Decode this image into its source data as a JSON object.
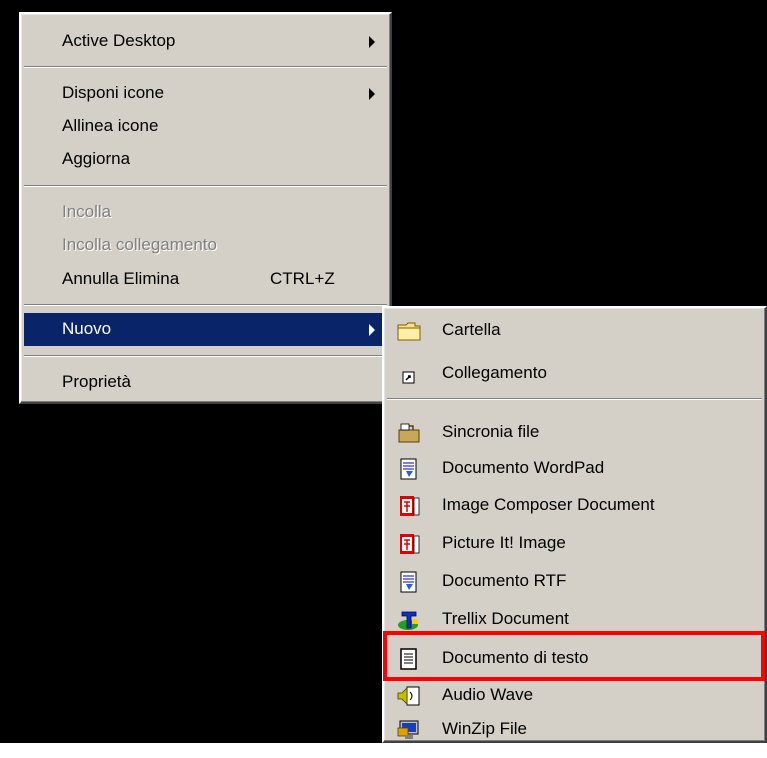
{
  "context_menu": {
    "items": [
      {
        "label": "Active Desktop",
        "has_submenu": true
      },
      {
        "label": "Disponi icone",
        "has_submenu": true
      },
      {
        "label": "Allinea icone"
      },
      {
        "label": "Aggiorna"
      },
      {
        "label": "Incolla",
        "disabled": true
      },
      {
        "label": "Incolla collegamento",
        "disabled": true
      },
      {
        "label": "Annulla Elimina",
        "shortcut": "CTRL+Z"
      },
      {
        "label": "Nuovo",
        "has_submenu": true,
        "selected": true
      },
      {
        "label": "Proprietà"
      }
    ]
  },
  "submenu_nuovo": {
    "items": [
      {
        "label": "Cartella",
        "icon": "folder-icon"
      },
      {
        "label": "Collegamento",
        "icon": "shortcut-icon"
      },
      {
        "label": "Sincronia file",
        "icon": "briefcase-icon"
      },
      {
        "label": "Documento WordPad",
        "icon": "wordpad-icon"
      },
      {
        "label": "Image Composer Document",
        "icon": "image-composer-icon"
      },
      {
        "label": "Picture It! Image",
        "icon": "picture-it-icon"
      },
      {
        "label": "Documento RTF",
        "icon": "rtf-icon"
      },
      {
        "label": "Trellix Document",
        "icon": "trellix-icon"
      },
      {
        "label": "Documento di testo",
        "icon": "notepad-icon",
        "highlighted": true
      },
      {
        "label": "Audio Wave",
        "icon": "audio-wave-icon"
      },
      {
        "label": "WinZip File",
        "icon": "winzip-icon"
      }
    ]
  },
  "colors": {
    "menu_bg": "#d4d0c8",
    "selection_bg": "#0a246a",
    "desktop_bg": "#000000",
    "highlight_border": "#ff0000",
    "disabled_text": "#808080"
  }
}
